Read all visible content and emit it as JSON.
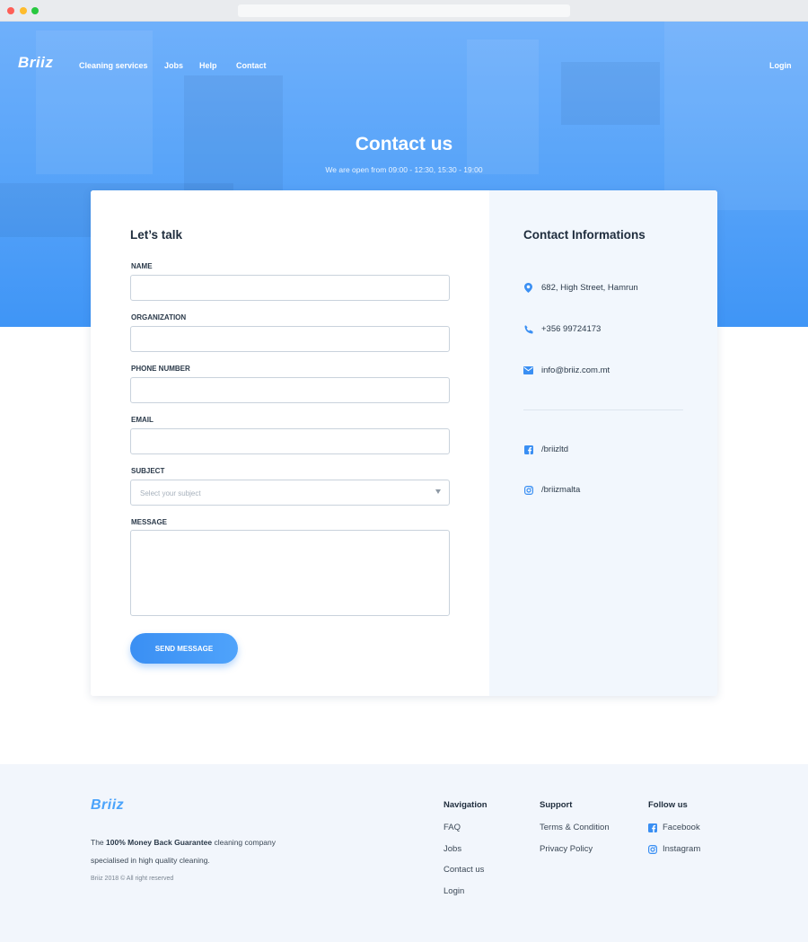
{
  "brand": {
    "name": "Briiz",
    "accent": "#3a8ff3"
  },
  "nav": {
    "items": [
      "Cleaning services",
      "Jobs",
      "Help",
      "Contact"
    ],
    "login": "Login"
  },
  "hero": {
    "title": "Contact us",
    "subtitle": "We are open from 09:00 - 12:30, 15:30 - 19:00"
  },
  "form": {
    "title": "Let’s talk",
    "fields": {
      "name": {
        "label": "NAME",
        "value": ""
      },
      "organization": {
        "label": "ORGANIZATION",
        "value": ""
      },
      "phone": {
        "label": "PHONE NUMBER",
        "value": ""
      },
      "email": {
        "label": "EMAIL",
        "value": ""
      },
      "subject": {
        "label": "SUBJECT",
        "placeholder": "Select your subject"
      },
      "message": {
        "label": "MESSAGE",
        "value": ""
      }
    },
    "submit_label": "SEND MESSAGE"
  },
  "contact_info": {
    "title": "Contact Informations",
    "address": {
      "icon": "location-pin-icon",
      "text": "682, High Street, Hamrun"
    },
    "phone": {
      "icon": "phone-icon",
      "text": "+356 99724173"
    },
    "email": {
      "icon": "mail-icon",
      "text": "info@briiz.com.mt"
    },
    "facebook": {
      "icon": "facebook-icon",
      "text": "/briizltd"
    },
    "instagram": {
      "icon": "instagram-icon",
      "text": "/briizmalta"
    }
  },
  "footer": {
    "logo": "Briiz",
    "desc_prefix": "The ",
    "desc_bold": "100% Money Back Guarantee",
    "desc_suffix": " cleaning company specialised in high quality cleaning.",
    "copyright": "Briiz 2018 © All right reserved",
    "navigation": {
      "heading": "Navigation",
      "links": [
        "FAQ",
        "Jobs",
        "Contact us",
        "Login"
      ]
    },
    "support": {
      "heading": "Support",
      "links": [
        "Terms & Condition",
        "Privacy Policy"
      ]
    },
    "follow": {
      "heading": "Follow us",
      "links": [
        "Facebook",
        "Instagram"
      ]
    }
  }
}
